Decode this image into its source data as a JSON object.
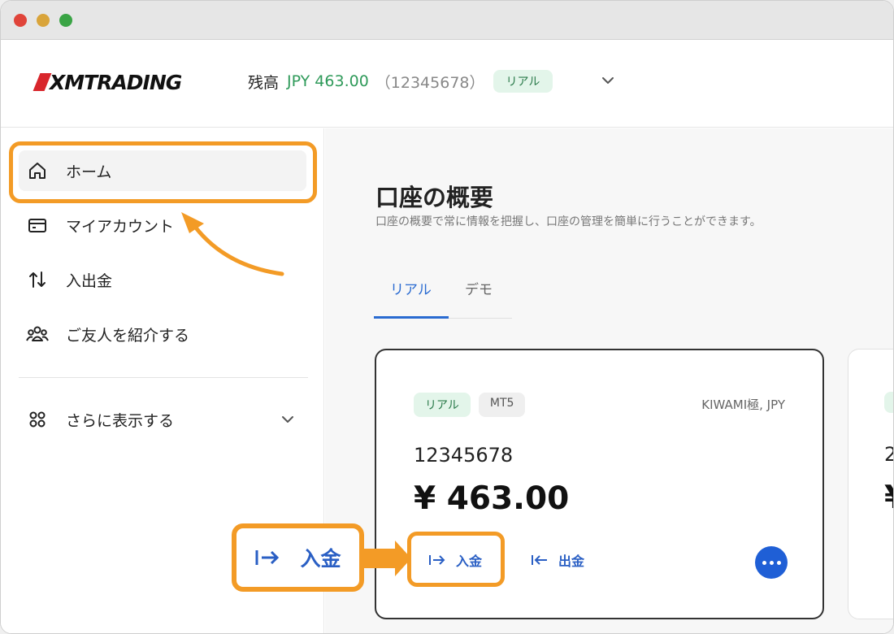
{
  "window": {
    "title": ""
  },
  "header": {
    "logo_text": "XMTRADING",
    "balance_label": "残高",
    "balance_amount": "JPY 463.00",
    "balance_account": "（12345678）",
    "account_badge": "リアル"
  },
  "sidebar": {
    "items": [
      {
        "label": "ホーム",
        "icon": "home-icon"
      },
      {
        "label": "マイアカウント",
        "icon": "card-icon"
      },
      {
        "label": "入出金",
        "icon": "transfer-icon"
      },
      {
        "label": "ご友人を紹介する",
        "icon": "people-icon"
      }
    ],
    "more_label": "さらに表示する"
  },
  "main": {
    "title": "口座の概要",
    "subtitle": "口座の概要で常に情報を把握し、口座の管理を簡単に行うことができます。",
    "tabs": [
      {
        "label": "リアル",
        "active": true
      },
      {
        "label": "デモ",
        "active": false
      }
    ],
    "card": {
      "badge_real": "リアル",
      "badge_platform": "MT5",
      "account_type": "KIWAMI極, JPY",
      "account_number": "12345678",
      "balance": "¥ 463.00",
      "deposit_label": "入金",
      "withdraw_label": "出金"
    },
    "card2": {
      "account_number_partial": "2",
      "balance_partial": "¥"
    }
  },
  "callout": {
    "label": "入金"
  },
  "colors": {
    "accent_blue": "#2a5fc4",
    "highlight_orange": "#f39b26",
    "balance_green": "#2f9a5a",
    "brand_red": "#d8262c"
  }
}
